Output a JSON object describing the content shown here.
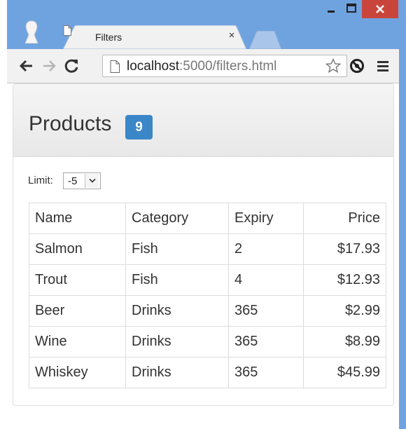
{
  "browser": {
    "tab_title": "Filters",
    "tab_close": "×",
    "url_host": "localhost",
    "url_path": ":5000/filters.html",
    "window_controls": {
      "minimize": "minimize-icon",
      "maximize": "maximize-icon",
      "close": "close-icon"
    },
    "accent_color": "#6fa3e0",
    "close_color": "#c9453c"
  },
  "page": {
    "title": "Products",
    "count_badge": "9",
    "badge_color": "#3a87c8",
    "limit_label": "Limit:",
    "limit_value": "-5",
    "table": {
      "columns": [
        "Name",
        "Category",
        "Expiry",
        "Price"
      ],
      "rows": [
        [
          "Salmon",
          "Fish",
          "2",
          "$17.93"
        ],
        [
          "Trout",
          "Fish",
          "4",
          "$12.93"
        ],
        [
          "Beer",
          "Drinks",
          "365",
          "$2.99"
        ],
        [
          "Wine",
          "Drinks",
          "365",
          "$8.99"
        ],
        [
          "Whiskey",
          "Drinks",
          "365",
          "$45.99"
        ]
      ]
    }
  }
}
